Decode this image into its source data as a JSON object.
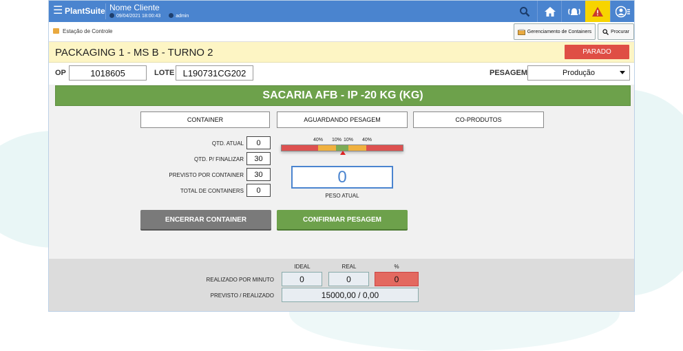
{
  "header": {
    "brand": "PlantSuite",
    "client": "Nome Cliente",
    "datetime": "09/04/2021 18:00:43",
    "user": "admin"
  },
  "toolbar": {
    "station": "Estação de Controle",
    "containers_button": "Gerenciamento de Containers",
    "search_button": "Procurar"
  },
  "production": {
    "title": "PACKAGING 1 - MS B - TURNO 2",
    "status": "PARADO",
    "status_color": "#df4e45",
    "op_label": "OP",
    "op_value": "1018605",
    "lote_label": "LOTE",
    "lote_value": "L190731CG202",
    "pesagem_label": "PESAGEM",
    "pesagem_value": "Produção",
    "product": "SACARIA AFB - IP -20 KG (KG)"
  },
  "tabs": {
    "container": "CONTAINER",
    "aguardando": "AGUARDANDO PESAGEM",
    "coprodutos": "CO-PRODUTOS"
  },
  "counters": {
    "qtd_atual_label": "QTD. ATUAL",
    "qtd_atual": "0",
    "qtd_finalizar_label": "QTD. P/ FINALIZAR",
    "qtd_finalizar": "30",
    "previsto_label": "PREVISTO POR CONTAINER",
    "previsto": "30",
    "total_label": "TOTAL DE CONTAINERS",
    "total": "0"
  },
  "gauge": {
    "labels": [
      "40%",
      "10%",
      "10%",
      "40%"
    ]
  },
  "weight": {
    "value": "0",
    "label": "PESO ATUAL"
  },
  "actions": {
    "close_container": "ENCERRAR CONTAINER",
    "confirm_weight": "CONFIRMAR PESAGEM"
  },
  "summary": {
    "col_ideal": "IDEAL",
    "col_real": "REAL",
    "col_pct": "%",
    "per_minute_label": "REALIZADO POR MINUTO",
    "ideal": "0",
    "real": "0",
    "pct": "0",
    "forecast_label": "PREVISTO / REALIZADO",
    "forecast_value": "15000,00 / 0,00"
  }
}
